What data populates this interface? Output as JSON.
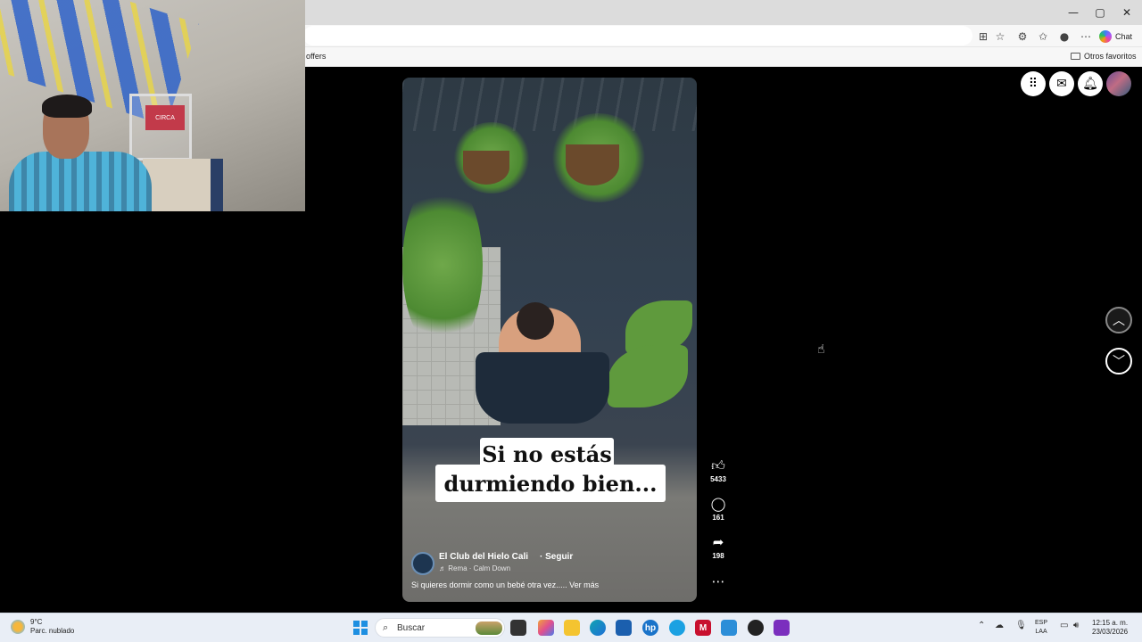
{
  "browser": {
    "chat_label": "Chat",
    "bookmarks": {
      "offers_label": "offers",
      "others_label": "Otros favoritos"
    },
    "window_controls": {
      "minimize": "—",
      "maximize": "▢",
      "close": "✕"
    }
  },
  "facebook_nav": {
    "icons": [
      "apps-grid-icon",
      "messenger-icon",
      "notifications-bell-icon",
      "profile-avatar"
    ]
  },
  "reel": {
    "caption_line1": "Si no estás",
    "caption_line2": "durmiendo bien...",
    "page_name": "El Club del Hielo Cali",
    "follow_label": "· Seguir",
    "music": "♬ Rema · Calm Down",
    "description": "Si quieres dormir como un bebé otra vez..... Ver más",
    "likes": "5433",
    "comments": "161",
    "shares": "198"
  },
  "taskbar": {
    "temperature": "9°C",
    "weather": "Parc. nublado",
    "search_placeholder": "Buscar",
    "lang_line1": "ESP",
    "lang_line2": "LAA",
    "time": "12:15 a. m.",
    "date": "23/03/2026"
  },
  "webcam": {
    "box_text": "CIRCA"
  }
}
